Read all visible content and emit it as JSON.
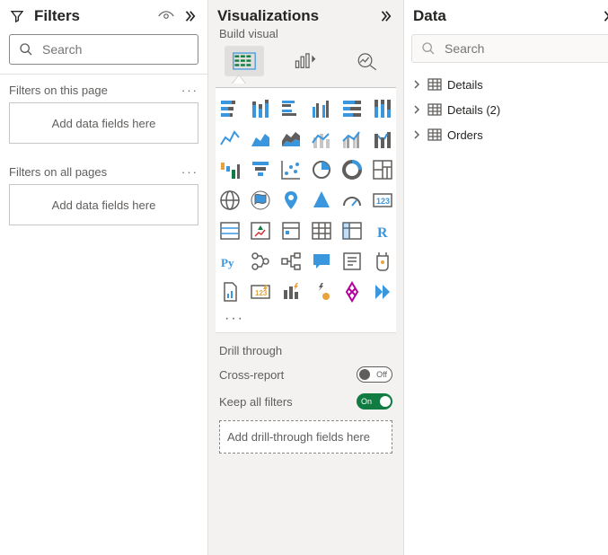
{
  "filters": {
    "title": "Filters",
    "search_placeholder": "Search",
    "sections": {
      "this_page": {
        "label": "Filters on this page",
        "drop_text": "Add data fields here"
      },
      "all_pages": {
        "label": "Filters on all pages",
        "drop_text": "Add data fields here"
      }
    }
  },
  "visualizations": {
    "title": "Visualizations",
    "subhead": "Build visual",
    "tabs": [
      "build-visual",
      "format-visual",
      "analytics"
    ],
    "gallery_icons": [
      "stacked-bar-chart",
      "stacked-column-chart",
      "clustered-bar-chart",
      "clustered-column-chart",
      "hundred-stacked-bar-chart",
      "hundred-stacked-column-chart",
      "line-chart",
      "area-chart",
      "stacked-area-chart",
      "line-stacked-column-chart",
      "line-clustered-column-chart",
      "ribbon-chart",
      "waterfall-chart",
      "funnel-chart",
      "scatter-chart",
      "pie-chart",
      "donut-chart",
      "treemap",
      "map",
      "filled-map",
      "azure-map",
      "arcgis-map",
      "gauge",
      "card",
      "multirow-card",
      "kpi",
      "slicer",
      "table",
      "matrix",
      "r-visual",
      "python-visual",
      "key-influencers",
      "decomposition-tree",
      "qa-visual",
      "smart-narrative",
      "paginated-report",
      "metrics",
      "power-automate",
      "power-apps",
      "shape-map-1",
      "shape-map-2",
      "double-chevron"
    ],
    "drill": {
      "title": "Drill through",
      "cross_report_label": "Cross-report",
      "cross_report_state": "Off",
      "keep_filters_label": "Keep all filters",
      "keep_filters_state": "On",
      "drop_text": "Add drill-through fields here"
    }
  },
  "data": {
    "title": "Data",
    "search_placeholder": "Search",
    "tables": [
      {
        "name": "Details"
      },
      {
        "name": "Details (2)"
      },
      {
        "name": "Orders"
      }
    ]
  }
}
